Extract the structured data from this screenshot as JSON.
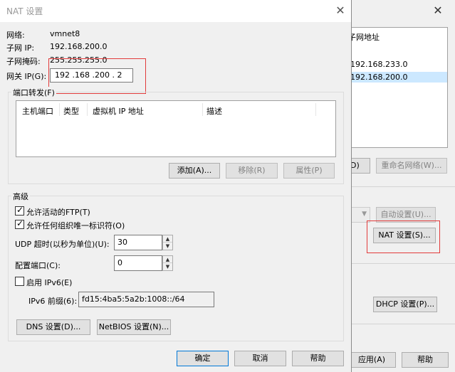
{
  "background_window": {
    "list_header": "子网地址",
    "list_rows": [
      "192.168.233.0",
      "192.168.200.0"
    ],
    "button_partial": "D)",
    "rename_button": "重命名网络(W)...",
    "auto_settings_button": "自动设置(U)...",
    "nat_settings_button": "NAT 设置(S)...",
    "dhcp_settings_button": "DHCP 设置(P)...",
    "apply_button": "应用(A)",
    "help_button": "帮助"
  },
  "dialog": {
    "title": "NAT 设置",
    "network_label": "网络:",
    "network_value": "vmnet8",
    "subnet_ip_label": "子网 IP:",
    "subnet_ip_value": "192.168.200.0",
    "subnet_mask_label": "子网掩码:",
    "subnet_mask_value": "255.255.255.0",
    "gateway_label": "网关 IP(G):",
    "gateway_value": "192 .168 .200 . 2",
    "port_forward": {
      "group_title": "端口转发(F)",
      "columns": [
        "主机端口",
        "类型",
        "虚拟机 IP 地址",
        "描述"
      ],
      "add_button": "添加(A)...",
      "remove_button": "移除(R)",
      "properties_button": "属性(P)"
    },
    "advanced": {
      "group_title": "高级",
      "allow_ftp": "允许活动的FTP(T)",
      "allow_ftp_checked": true,
      "allow_oui": "允许任何组织唯一标识符(O)",
      "allow_oui_checked": true,
      "udp_timeout_label": "UDP 超时(以秒为单位)(U):",
      "udp_timeout_value": "30",
      "config_port_label": "配置端口(C):",
      "config_port_value": "0",
      "enable_ipv6": "启用 IPv6(E)",
      "enable_ipv6_checked": false,
      "ipv6_prefix_label": "IPv6 前缀(6):",
      "ipv6_prefix_value": "fd15:4ba5:5a2b:1008::/64",
      "dns_button": "DNS 设置(D)...",
      "netbios_button": "NetBIOS 设置(N)..."
    },
    "ok_button": "确定",
    "cancel_button": "取消",
    "help_button": "帮助"
  },
  "colors": {
    "highlight_box": "#e23b3b",
    "selection": "#cce8ff",
    "dialog_bg": "#f0f0f0"
  }
}
